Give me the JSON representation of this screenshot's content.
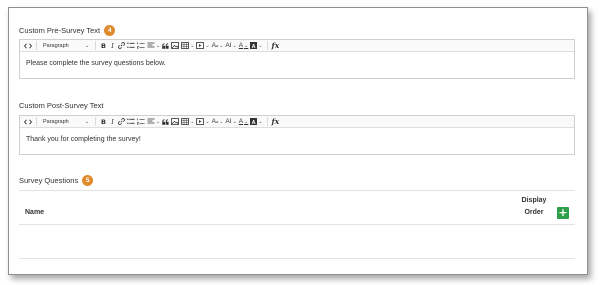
{
  "pre_survey": {
    "label": "Custom Pre-Survey Text",
    "step": "4",
    "content": "Please complete the survey questions below."
  },
  "post_survey": {
    "label": "Custom Post-Survey Text",
    "content": "Thank you for completing the survey!"
  },
  "toolbar": {
    "paragraph_label": "Paragraph",
    "text_color_label": "A",
    "font_size_label": "AI",
    "fx_label": "fx"
  },
  "questions": {
    "label": "Survey Questions",
    "step": "5",
    "columns": {
      "name": "Name",
      "display": "Display",
      "order": "Order"
    },
    "add_label": "+"
  },
  "colors": {
    "step_badge": "#e08a2c",
    "add_button": "#2e9e4a"
  }
}
